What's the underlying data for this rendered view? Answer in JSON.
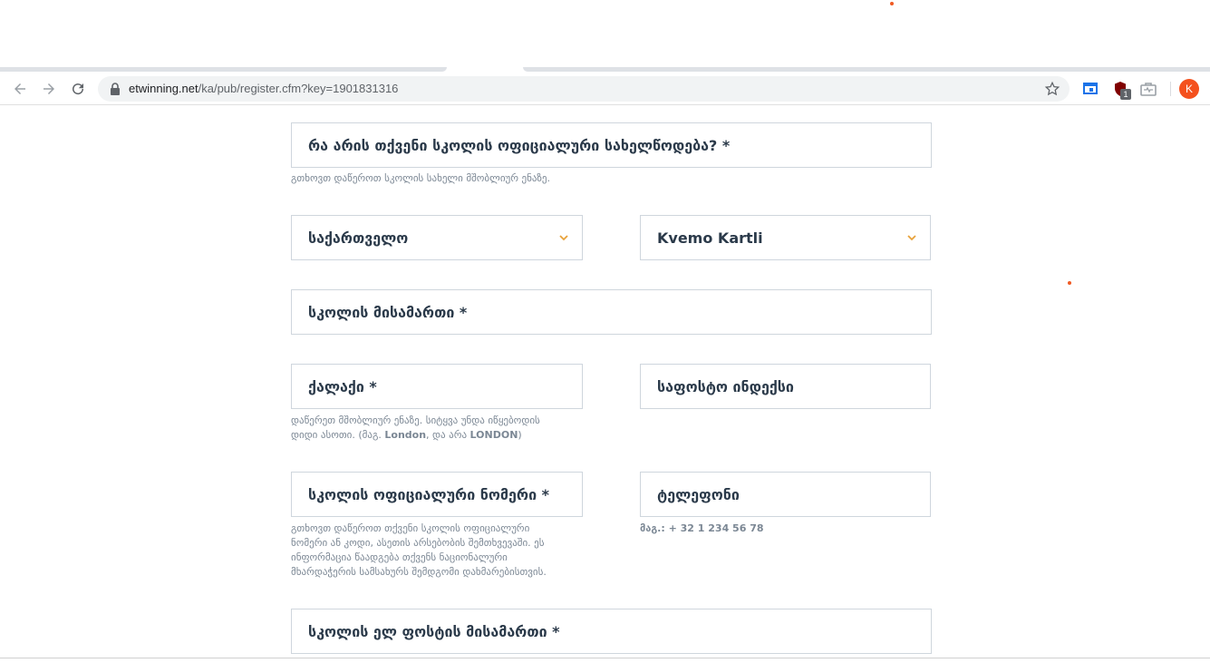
{
  "browser": {
    "url_host": "etwinning.net",
    "url_path": "/ka/pub/register.cfm?key=1901831316",
    "extension_badge": "1",
    "profile_initial": "K"
  },
  "form": {
    "school_name_label": "რა არის თქვენი სკოლის ოფიციალური სახელწოდება? *",
    "school_name_hint": "გთხოვთ დაწეროთ სკოლის სახელი მშობლიურ ენაზე.",
    "country_value": "საქართველო",
    "region_value": "Kvemo Kartli",
    "address_label": "სკოლის მისამართი *",
    "city_label": "ქალაქი *",
    "city_hint_line1": "დაწერეთ მშობლიურ ენაზე. სიტყვა უნდა იწყებოდის",
    "city_hint_line2_a": "დიდი ასოთი. (მაგ. ",
    "city_hint_example1": "London",
    "city_hint_line2_b": ", და არა ",
    "city_hint_example2": "LONDON",
    "city_hint_line2_c": ")",
    "postcode_label": "საფოსტო ინდექსი",
    "official_number_label": "სკოლის ოფიციალური ნომერი *",
    "official_number_hint_1": "გთხოვთ დაწეროთ თქვენი სკოლის ოფიციალური",
    "official_number_hint_2": "ნომერი ან კოდი, ასეთის არსებობის შემთხვევაში. ეს",
    "official_number_hint_3": "ინფორმაცია წაადგება თქვენს ნაციონალური",
    "official_number_hint_4": "მხარდაჭერის სამსახურს შემდგომი დახმარებისთვის.",
    "phone_label": "ტელეფონი",
    "phone_hint": "მაგ.: + 32 1 234 56 78",
    "email_label": "სკოლის ელ ფოსტის მისამართი *"
  },
  "colors": {
    "accent": "#f05a23",
    "field_border": "#cfd6dd",
    "hint_text": "#7b8794"
  }
}
